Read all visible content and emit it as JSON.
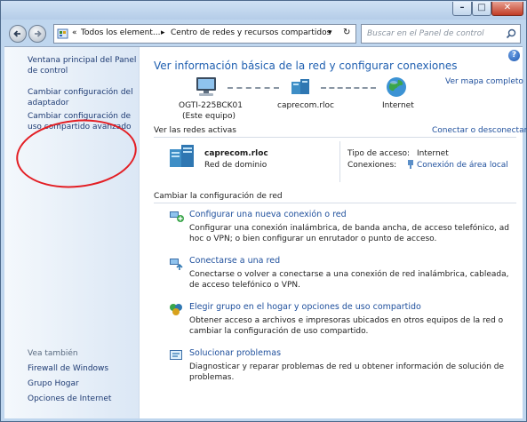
{
  "titlebar": {
    "minimize": "–",
    "maximize": "□",
    "close": "✕"
  },
  "nav": {
    "back_icon": "back-arrow-icon",
    "forward_icon": "forward-arrow-icon",
    "address": {
      "chevron": "«",
      "seg1": "Todos los element...",
      "sep": "▸",
      "seg2": "Centro de redes y recursos compartidos",
      "dropdown": "▾",
      "refresh": "↻"
    },
    "search_placeholder": "Buscar en el Panel de control"
  },
  "sidebar": {
    "home": "Ventana principal del Panel de control",
    "change_adapter": "Cambiar configuración del adaptador",
    "advanced_sharing": "Cambiar configuración de uso compartido avanzado",
    "see_also_title": "Vea también",
    "see_also": [
      "Firewall de Windows",
      "Grupo Hogar",
      "Opciones de Internet"
    ]
  },
  "main": {
    "title": "Ver información básica de la red y configurar conexiones",
    "full_map": "Ver mapa completo",
    "map": {
      "computer_name": "OGTI-225BCK01",
      "computer_sub": "(Este equipo)",
      "network_name": "caprecom.rloc",
      "internet": "Internet"
    },
    "active_header": "Ver las redes activas",
    "connect_disconnect": "Conectar o desconectar",
    "active_network": {
      "name": "caprecom.rloc",
      "type": "Red de dominio",
      "access_label": "Tipo de acceso:",
      "access_value": "Internet",
      "connections_label": "Conexiones:",
      "connections_value": "Conexión de área local"
    },
    "change_header": "Cambiar la configuración de red",
    "tasks": [
      {
        "link": "Configurar una nueva conexión o red",
        "desc": "Configurar una conexión inalámbrica, de banda ancha, de acceso telefónico, ad hoc o VPN; o bien configurar un enrutador o punto de acceso."
      },
      {
        "link": "Conectarse a una red",
        "desc": "Conectarse o volver a conectarse a una conexión de red inalámbrica, cableada, de acceso telefónico o VPN."
      },
      {
        "link": "Elegir grupo en el hogar y opciones de uso compartido",
        "desc": "Obtener acceso a archivos e impresoras ubicados en otros equipos de la red o cambiar la configuración de uso compartido."
      },
      {
        "link": "Solucionar problemas",
        "desc": "Diagnosticar y reparar problemas de red u obtener información de solución de problemas."
      }
    ]
  },
  "colors": {
    "link": "#1e4f9c",
    "title": "#1f5fb0",
    "annotation": "#e31e24"
  }
}
